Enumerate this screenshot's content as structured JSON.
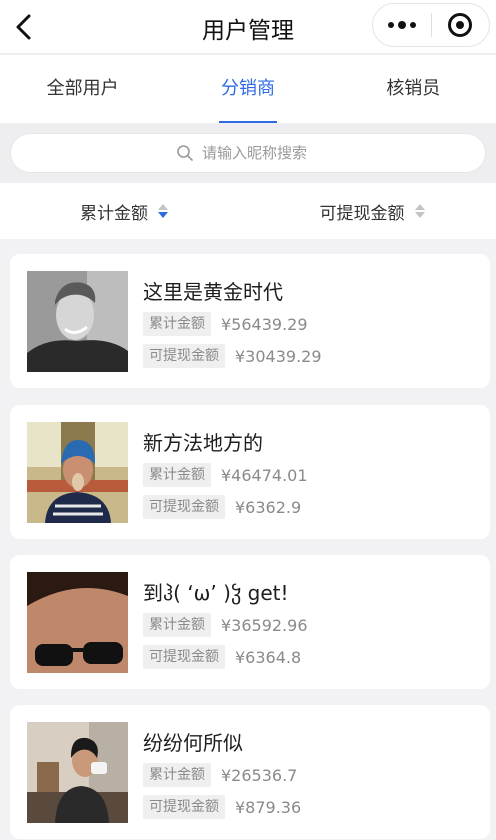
{
  "navbar": {
    "title": "用户管理",
    "back_icon": "chevron-left-icon",
    "more_icon": "more-dots-icon",
    "close_icon": "target-close-icon"
  },
  "tabs": [
    {
      "label": "全部用户",
      "active": false
    },
    {
      "label": "分销商",
      "active": true
    },
    {
      "label": "核销员",
      "active": false
    }
  ],
  "search": {
    "placeholder": "请输入昵称搜索",
    "value": ""
  },
  "sort": {
    "total_label": "累计金额",
    "withdrawable_label": "可提现金额",
    "active": "total",
    "direction": "desc"
  },
  "users": [
    {
      "name": "这里是黄金时代",
      "total_label": "累计金额",
      "total": "¥56439.29",
      "withdrawable_label": "可提现金额",
      "withdrawable": "¥30439.29"
    },
    {
      "name": "新方法地方的",
      "total_label": "累计金额",
      "total": "¥46474.01",
      "withdrawable_label": "可提现金额",
      "withdrawable": "¥6362.9"
    },
    {
      "name": "到ჰ( ‘ω’ )ჴ get!",
      "total_label": "累计金额",
      "total": "¥36592.96",
      "withdrawable_label": "可提现金额",
      "withdrawable": "¥6364.8"
    },
    {
      "name": "纷纷何所似",
      "total_label": "累计金额",
      "total": "¥26536.7",
      "withdrawable_label": "可提现金额",
      "withdrawable": "¥879.36"
    }
  ],
  "colors": {
    "accent": "#2e6ae6",
    "tag_bg": "#efefef",
    "muted": "#8a8a8a"
  }
}
